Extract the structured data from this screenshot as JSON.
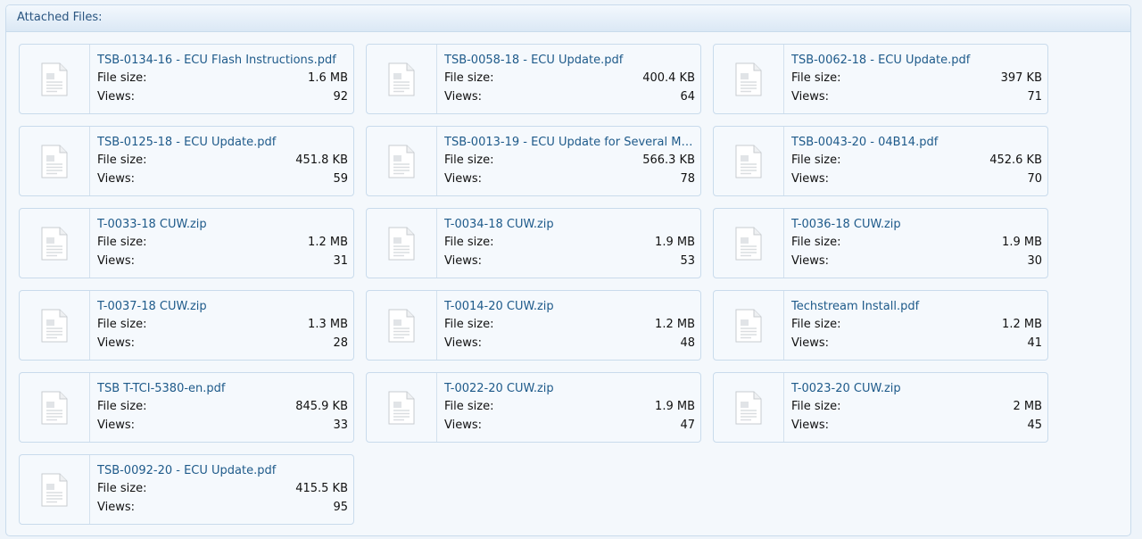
{
  "header": {
    "title": "Attached Files:"
  },
  "labels": {
    "file_size": "File size:",
    "views": "Views:"
  },
  "files": [
    {
      "name": "TSB-0134-16 - ECU Flash Instructions.pdf",
      "size": "1.6 MB",
      "views": "92"
    },
    {
      "name": "TSB-0058-18 - ECU Update.pdf",
      "size": "400.4 KB",
      "views": "64"
    },
    {
      "name": "TSB-0062-18 - ECU Update.pdf",
      "size": "397 KB",
      "views": "71"
    },
    {
      "name": "TSB-0125-18 - ECU Update.pdf",
      "size": "451.8 KB",
      "views": "59"
    },
    {
      "name": "TSB-0013-19 - ECU Update for Several Mod...",
      "size": "566.3 KB",
      "views": "78"
    },
    {
      "name": "TSB-0043-20 - 04B14.pdf",
      "size": "452.6 KB",
      "views": "70"
    },
    {
      "name": "T-0033-18 CUW.zip",
      "size": "1.2 MB",
      "views": "31"
    },
    {
      "name": "T-0034-18 CUW.zip",
      "size": "1.9 MB",
      "views": "53"
    },
    {
      "name": "T-0036-18 CUW.zip",
      "size": "1.9 MB",
      "views": "30"
    },
    {
      "name": "T-0037-18 CUW.zip",
      "size": "1.3 MB",
      "views": "28"
    },
    {
      "name": "T-0014-20 CUW.zip",
      "size": "1.2 MB",
      "views": "48"
    },
    {
      "name": "Techstream Install.pdf",
      "size": "1.2 MB",
      "views": "41"
    },
    {
      "name": "TSB T-TCI-5380-en.pdf",
      "size": "845.9 KB",
      "views": "33"
    },
    {
      "name": "T-0022-20 CUW.zip",
      "size": "1.9 MB",
      "views": "47"
    },
    {
      "name": "T-0023-20 CUW.zip",
      "size": "2 MB",
      "views": "45"
    },
    {
      "name": "TSB-0092-20 - ECU Update.pdf",
      "size": "415.5 KB",
      "views": "95"
    }
  ],
  "icons": {
    "file": "generic-document-icon"
  },
  "colors": {
    "link": "#1e5a8a",
    "border": "#c9dbec",
    "header_text": "#2a5580"
  }
}
